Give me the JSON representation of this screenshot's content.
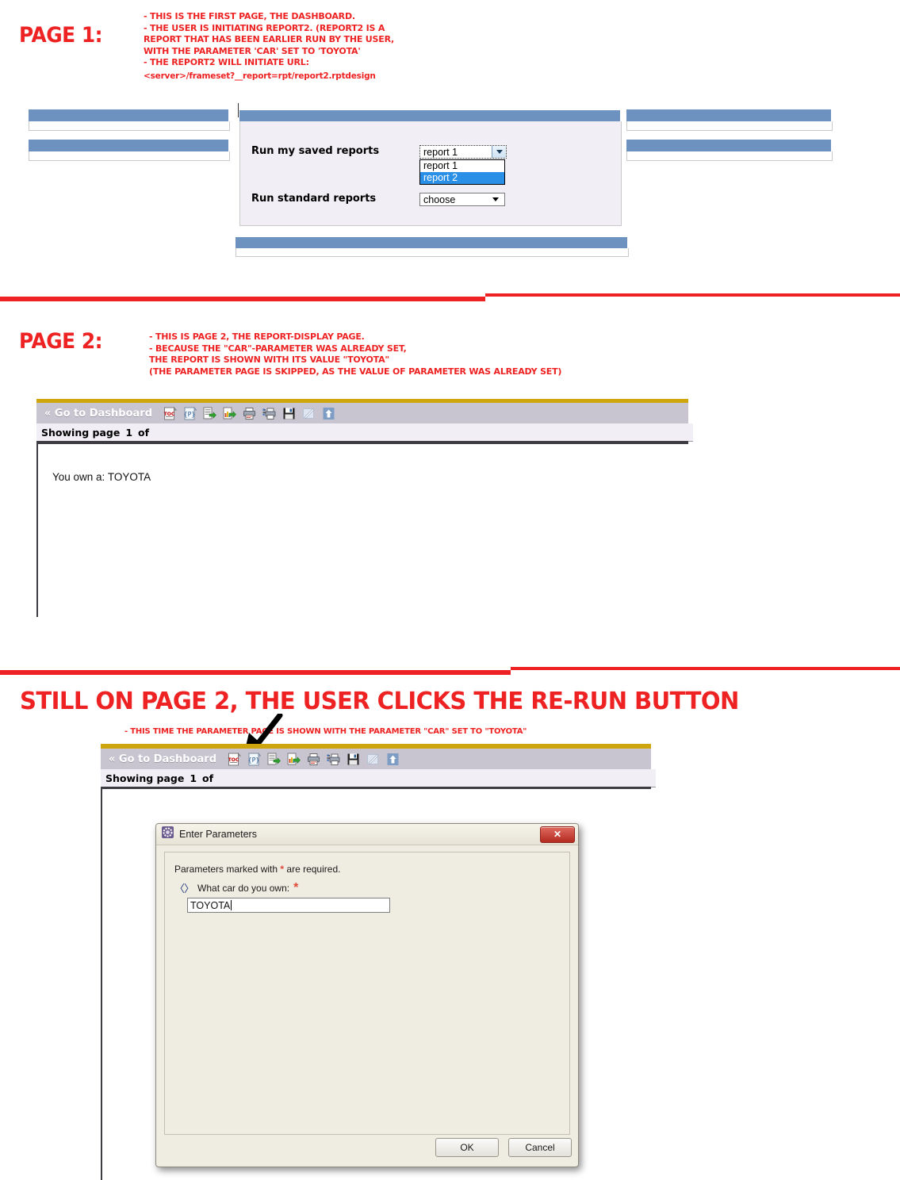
{
  "section1": {
    "page_label": "PAGE 1:",
    "annotations": [
      "- THIS IS THE FIRST PAGE, THE DASHBOARD.",
      "- THE USER IS INITIATING REPORT2. (REPORT2 IS A",
      "REPORT THAT HAS BEEN EARLIER RUN BY THE USER,",
      "WITH THE PARAMETER 'CAR' SET TO 'TOYOTA'",
      "- THE REPORT2 WILL INITIATE URL:",
      "<server>/frameset?__report=rpt/report2.rptdesign"
    ],
    "dashboard": {
      "saved_reports_label": "Run my saved reports",
      "saved_reports_value": "report 1",
      "saved_reports_options": [
        "report 1",
        "report 2"
      ],
      "saved_reports_highlighted": "report 2",
      "standard_reports_label": "Run standard reports",
      "standard_reports_value": "choose"
    }
  },
  "section2": {
    "page_label": "PAGE 2:",
    "annotations": [
      "- THIS IS PAGE 2, THE REPORT-DISPLAY PAGE.",
      "- BECAUSE THE \"CAR\"-PARAMETER WAS ALREADY SET,",
      "THE REPORT IS SHOWN WITH ITS VALUE \"TOYOTA\"",
      "(THE PARAMETER PAGE IS SKIPPED, AS THE VALUE OF PARAMETER WAS ALREADY SET)"
    ],
    "viewer": {
      "go_to_dashboard": "« Go to Dashboard",
      "status_prefix": "Showing page",
      "page_number": "1",
      "status_suffix": "of",
      "report_text": "You own a: TOYOTA",
      "icons": [
        "toc-icon",
        "parameters-icon",
        "export-report-icon",
        "export-data-icon",
        "print-icon",
        "print-to-server-icon",
        "save-icon",
        "edit-icon",
        "rerun-icon"
      ]
    }
  },
  "section3": {
    "heading": "STILL ON PAGE 2, THE USER CLICKS THE RE-RUN BUTTON",
    "annotation": "- THIS TIME THE PARAMETER PAGE IS SHOWN WITH THE PARAMETER \"CAR\" SET TO \"TOYOTA\"",
    "viewer": {
      "go_to_dashboard": "« Go to Dashboard",
      "status_prefix": "Showing page",
      "page_number": "1",
      "status_suffix": "of"
    },
    "dialog": {
      "title": "Enter Parameters",
      "close_label": "✕",
      "required_note_prefix": "Parameters marked with",
      "required_note_star": "*",
      "required_note_suffix": "are required.",
      "param_icon": "〈〉",
      "param_label": "What car do you own:",
      "param_required_star": "*",
      "param_value": "TOYOTA",
      "ok_label": "OK",
      "cancel_label": "Cancel"
    }
  },
  "colors": {
    "annotation_red": "#ee2222",
    "panel_blue": "#6d92c0",
    "viewer_gold": "#cfa50e",
    "toolbar_gray": "#c8c5d0",
    "dropdown_highlight": "#2a8fe7"
  }
}
